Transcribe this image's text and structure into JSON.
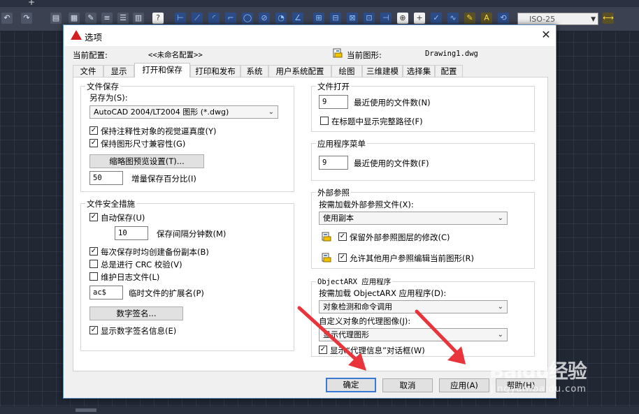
{
  "toolbar": {
    "iso_combo": "ISO-25"
  },
  "dialog": {
    "title": "选项",
    "current_config_label": "当前配置:",
    "current_config_value": "<<未命名配置>>",
    "current_drawing_label": "当前图形:",
    "current_drawing_value": "Drawing1.dwg",
    "tabs": [
      {
        "label": "文件"
      },
      {
        "label": "显示"
      },
      {
        "label": "打开和保存"
      },
      {
        "label": "打印和发布"
      },
      {
        "label": "系统"
      },
      {
        "label": "用户系统配置"
      },
      {
        "label": "绘图"
      },
      {
        "label": "三维建模"
      },
      {
        "label": "选择集"
      },
      {
        "label": "配置"
      }
    ],
    "file_save": {
      "title": "文件保存",
      "save_as_label": "另存为(S):",
      "save_as_value": "AutoCAD 2004/LT2004 图形 (*.dwg)",
      "keep_annotative": "保持注释性对象的视觉逼真度(Y)",
      "keep_dimension": "保持图形尺寸兼容性(G)",
      "thumbnail_button": "缩略图预览设置(T)...",
      "incremental_value": "50",
      "incremental_label": "增量保存百分比(I)"
    },
    "file_safety": {
      "title": "文件安全措施",
      "autosave": "自动保存(U)",
      "minutes_value": "10",
      "minutes_label": "保存间隔分钟数(M)",
      "backup": "每次保存时均创建备份副本(B)",
      "crc": "总是进行 CRC 校验(V)",
      "log": "维护日志文件(L)",
      "temp_ext_value": "ac$",
      "temp_ext_label": "临时文件的扩展名(P)",
      "digital_sig_button": "数字签名...",
      "show_sig": "显示数字签名信息(E)"
    },
    "file_open": {
      "title": "文件打开",
      "recent_value": "9",
      "recent_label": "最近使用的文件数(N)",
      "full_path": "在标题中显示完整路径(F)"
    },
    "app_menu": {
      "title": "应用程序菜单",
      "recent_value": "9",
      "recent_label": "最近使用的文件数(F)"
    },
    "xref": {
      "title": "外部参照",
      "demand_load_label": "按需加载外部参照文件(X):",
      "demand_load_value": "使用副本",
      "retain_changes": "保留外部参照图层的修改(C)",
      "allow_others": "允许其他用户参照编辑当前图形(R)"
    },
    "objectarx": {
      "title": "ObjectARX 应用程序",
      "demand_load_label": "按需加载 ObjectARX 应用程序(D):",
      "demand_load_value": "对象检测和命令调用",
      "proxy_label": "自定义对象的代理图像(J):",
      "proxy_value": "显示代理图形",
      "proxy_dialog": "显示“代理信息”对话框(W)"
    },
    "buttons": {
      "ok": "确定",
      "cancel": "取消",
      "apply": "应用(A)",
      "help": "帮助(H)"
    }
  },
  "watermark": {
    "title": "Baidu经验",
    "subtitle": "jingyan.baidu.com"
  },
  "colors": {
    "annotation_arrow": "#e8343a",
    "dialog_border": "#5b8cc8",
    "default_button_border": "#3a78d6"
  }
}
